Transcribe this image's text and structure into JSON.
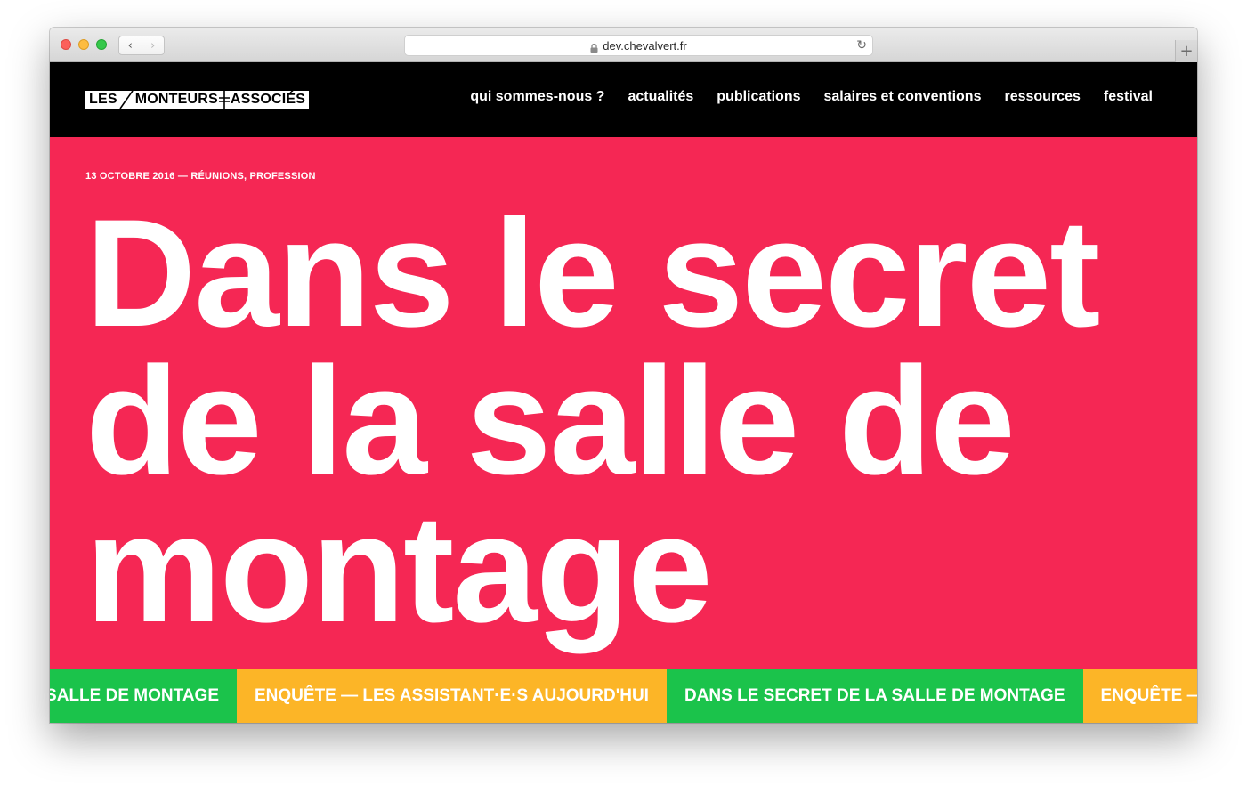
{
  "browser": {
    "url": "dev.chevalvert.fr",
    "back_glyph": "‹",
    "forward_glyph": "›",
    "reload_glyph": "↻",
    "newtab_glyph": "+"
  },
  "site": {
    "logo": {
      "part1": "LES",
      "part2": "MONTEURS",
      "part3": "ASSOCIÉS"
    },
    "nav": [
      {
        "label": "qui sommes-nous ?"
      },
      {
        "label": "actualités"
      },
      {
        "label": "publications"
      },
      {
        "label": "salaires et conventions"
      },
      {
        "label": "ressources"
      },
      {
        "label": "festival"
      }
    ]
  },
  "article": {
    "date": "13 OCTOBRE 2016",
    "separator": " — ",
    "categories": [
      "RÉUNIONS",
      "PROFESSION"
    ],
    "title_lines": [
      "Dans le secret",
      "de la salle de",
      "montage"
    ]
  },
  "ticker": [
    {
      "label": "DANS LE SECRET DE LA SALLE DE MONTAGE",
      "color": "#1bc34b"
    },
    {
      "label": "ENQUÊTE — LES ASSISTANT·E·S AUJOURD'HUI",
      "color": "#fcb527"
    },
    {
      "label": "DANS LE SECRET DE LA SALLE DE MONTAGE",
      "color": "#1bc34b"
    },
    {
      "label": "ENQUÊTE — LES ASSISTANT·E·S AUJOURD'HUI",
      "color": "#fcb527"
    }
  ],
  "colors": {
    "hero_bg": "#f52754",
    "header_bg": "#000000",
    "ticker_green": "#1bc34b",
    "ticker_yellow": "#fcb527"
  }
}
